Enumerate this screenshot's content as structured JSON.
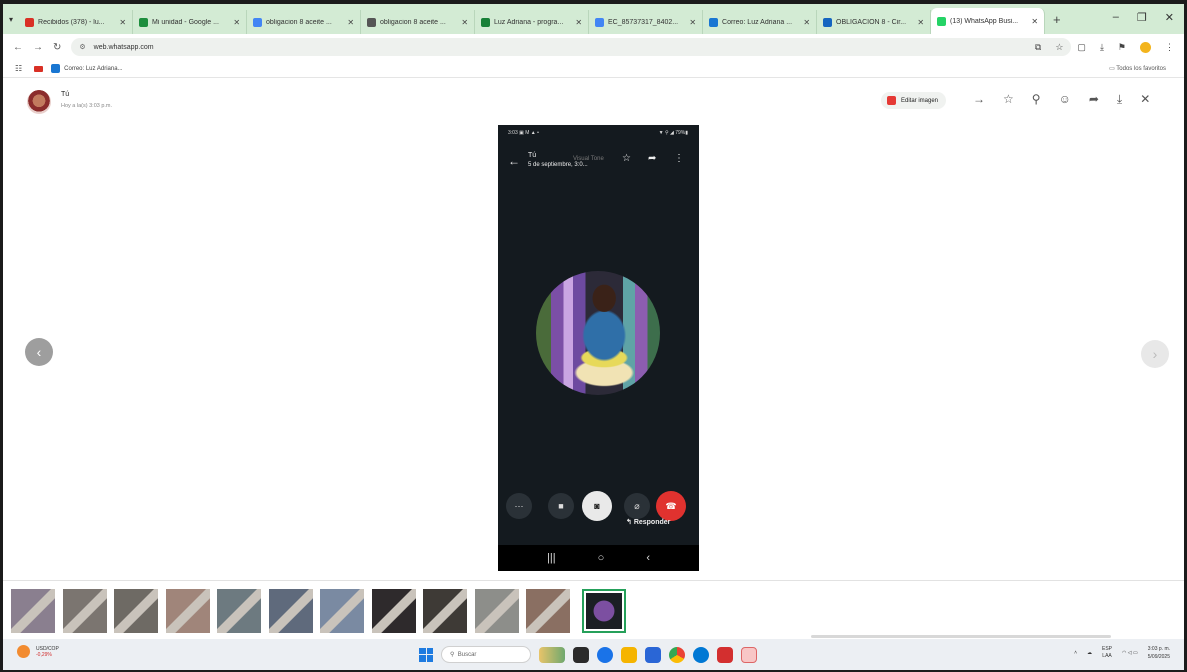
{
  "browser": {
    "tabs": [
      {
        "label": "Recibidos (378) - lu...",
        "color": "#d93025"
      },
      {
        "label": "Mi unidad - Google ...",
        "color": "#1e8e3e"
      },
      {
        "label": "obligacion 8 aceite ...",
        "color": "#4285f4"
      },
      {
        "label": "obligacion 8 aceite ...",
        "color": "#555555"
      },
      {
        "label": "Luz Adriana - progra...",
        "color": "#188038"
      },
      {
        "label": "EC_85737317_8402...",
        "color": "#4285f4"
      },
      {
        "label": "Correo: Luz Adriana ...",
        "color": "#1976d2"
      },
      {
        "label": "OBLIGACIÓN 8 - Cir...",
        "color": "#1565c0"
      },
      {
        "label": "(13) WhatsApp Busi...",
        "color": "#25d366",
        "active": true
      }
    ],
    "new_tab": "+",
    "url": "web.whatsapp.com",
    "bookmarks": {
      "item1": "Correo: Luz Adriana...",
      "all_favorites": "Todos los favoritos"
    }
  },
  "viewer": {
    "sender": "Tú",
    "time": "Hoy a la(s) 3:03 p.m.",
    "edit_button": "Editar imagen",
    "icons": [
      "forward-icon",
      "star-icon",
      "pin-icon",
      "emoji-icon",
      "share-icon",
      "download-icon",
      "close-icon"
    ]
  },
  "phone": {
    "status_left": "3:03 ▣ M ▲ •",
    "status_right": "▼ ⚲ ◢ 79%▮",
    "header_name": "Tú",
    "header_date": "5 de septiembre, 3:0...",
    "header_ghost": "Visual Tone",
    "reply_label": "Responder"
  },
  "thumbnails": {
    "count": 12,
    "colors": [
      "#8a7f8f",
      "#7b7570",
      "#6e6a64",
      "#a0857a",
      "#6d7a80",
      "#5f6a7c",
      "#7a8aa2",
      "#2e2a2c",
      "#3e3a36",
      "#8d8e8a",
      "#8a6f62"
    ]
  },
  "taskbar": {
    "weather_title": "USD/COP",
    "weather_value": "-0,29%",
    "search_placeholder": "Buscar",
    "lang_top": "ESP",
    "lang_bottom": "LAA",
    "time": "3:03 p. m.",
    "date": "5/09/2025"
  }
}
